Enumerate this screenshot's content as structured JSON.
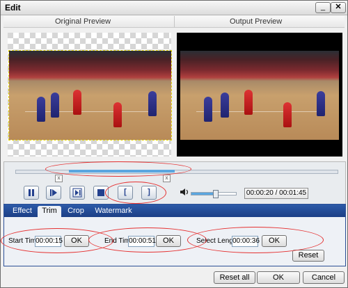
{
  "window": {
    "title": "Edit"
  },
  "titlebar": {
    "minimize_glyph": "_",
    "close_glyph": "✕"
  },
  "preview": {
    "original_label": "Original Preview",
    "output_label": "Output Preview"
  },
  "scrubber": {
    "progress_fraction": 0.33
  },
  "playback": {
    "volume_fraction": 0.53,
    "time_display": "00:00:20 / 00:01:45",
    "mark_in_glyph": "[",
    "mark_out_glyph": "]"
  },
  "tabs": [
    {
      "label": "Effect"
    },
    {
      "label": "Trim"
    },
    {
      "label": "Crop"
    },
    {
      "label": "Watermark"
    }
  ],
  "trim": {
    "start_label": "Start Time",
    "start_value": "00:00:15",
    "end_label": "End Time",
    "end_value": "00:00:51",
    "length_label": "Select Length",
    "length_value": "00:00:36",
    "ok_label": "OK",
    "reset_label": "Reset"
  },
  "footer": {
    "reset_all_label": "Reset all",
    "ok_label": "OK",
    "cancel_label": "Cancel"
  },
  "colors": {
    "accent_tab_bar": "#1c3f86",
    "annotation_red": "#e53030"
  }
}
